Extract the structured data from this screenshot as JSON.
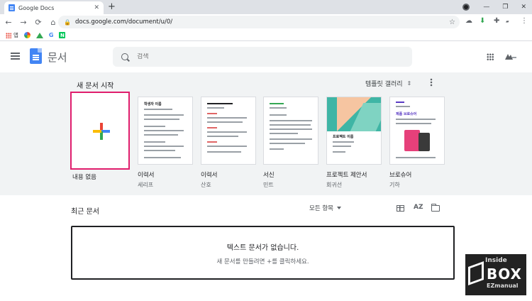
{
  "browser": {
    "tab_title": "Google Docs",
    "tab_close": "✕",
    "new_tab": "+",
    "window_controls": [
      "—",
      "❐",
      "✕"
    ],
    "url": "docs.google.com/document/u/0/",
    "nav": [
      "←",
      "→",
      "⟳",
      "⌂"
    ]
  },
  "bookmarks": {
    "apps_label": "앱",
    "items": [
      {
        "icon": "photos-icon"
      },
      {
        "icon": "drive-icon"
      },
      {
        "icon": "google-icon",
        "text": "G"
      },
      {
        "icon": "naver-icon",
        "text": "N"
      }
    ]
  },
  "header": {
    "app_title": "문서",
    "search_placeholder": "검색"
  },
  "gallery": {
    "title": "새 문서 시작",
    "link": "템플릿 갤러리",
    "templates": [
      {
        "name": "내용 없음",
        "sub": ""
      },
      {
        "name": "이력서",
        "sub": "세리프",
        "heading": "학생자 이름"
      },
      {
        "name": "이력서",
        "sub": "산호"
      },
      {
        "name": "서신",
        "sub": "민트"
      },
      {
        "name": "프로젝트 제안서",
        "sub": "회귀선",
        "heading": "프로젝트 이름"
      },
      {
        "name": "브로슈어",
        "sub": "기하",
        "heading": "제품 브로슈어"
      }
    ]
  },
  "recent": {
    "title": "최근 문서",
    "owner_filter": "모든 항목",
    "sort_label": "AZ",
    "empty_title": "텍스트 문서가 없습니다.",
    "empty_sub": "새 문서를 만들려면 +를 클릭하세요."
  },
  "watermark": {
    "line1": "Inside",
    "line2": "BOX",
    "line3": "EZmanual"
  },
  "colors": {
    "blank_highlight": "#e01e6d",
    "docs_blue": "#4285f4",
    "band": "#f1f3f4"
  }
}
